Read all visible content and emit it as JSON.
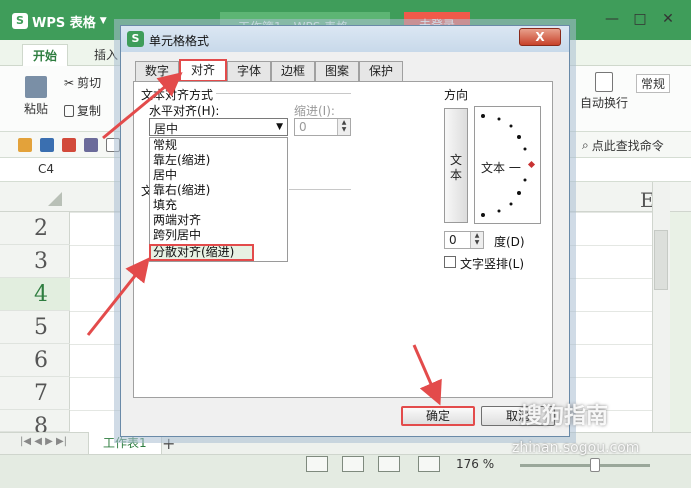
{
  "app": {
    "name": "WPS 表格",
    "doc_tab": "工作簿1 - WPS 表格",
    "login_label": "未登录",
    "window_controls": [
      "—",
      "□",
      "✕"
    ]
  },
  "ribbon": {
    "tabs": [
      "开始",
      "插入"
    ],
    "active_tab": "开始",
    "items": {
      "paste": "粘贴",
      "cut": "剪切",
      "copy": "复制",
      "wrap": "自动换行",
      "normal": "常规",
      "find_cmd": "点此查找命令"
    }
  },
  "sheet": {
    "cell_ref": "C4",
    "col_label": "E",
    "rows": [
      "2",
      "3",
      "4",
      "5",
      "6",
      "7",
      "8"
    ],
    "selected_row": "4",
    "sheet_tab": "工作表1",
    "zoom": "176 %"
  },
  "dialog": {
    "title": "单元格格式",
    "close": "X",
    "tabs": [
      "数字",
      "对齐",
      "字体",
      "边框",
      "图案",
      "保护"
    ],
    "active_tab": "对齐",
    "text_align_section": "文本对齐方式",
    "h_align_label": "水平对齐(H):",
    "h_align_value": "居中",
    "indent_label": "缩进(I):",
    "indent_value": "0",
    "dropdown_options": [
      "常规",
      "靠左(缩进)",
      "居中",
      "靠右(缩进)",
      "填充",
      "两端对齐",
      "跨列居中",
      "分散对齐(缩进)"
    ],
    "highlighted_option": "分散对齐(缩进)",
    "partial_labels": [
      "文",
      "文"
    ],
    "orientation_label": "方向",
    "vertical_text": "文本",
    "dial_text": "文本 一",
    "degree_value": "0",
    "degree_label": "度(D)",
    "vertical_check": "文字竖排(L)",
    "ok": "确定",
    "cancel": "取消"
  },
  "watermark": {
    "text": "搜狗指南",
    "url": "zhinan.sogou.com"
  },
  "colors": {
    "title_green": "#3f9d5a",
    "annotation_red": "#e34b4b",
    "dialog_bg": "#f0f0f0"
  }
}
